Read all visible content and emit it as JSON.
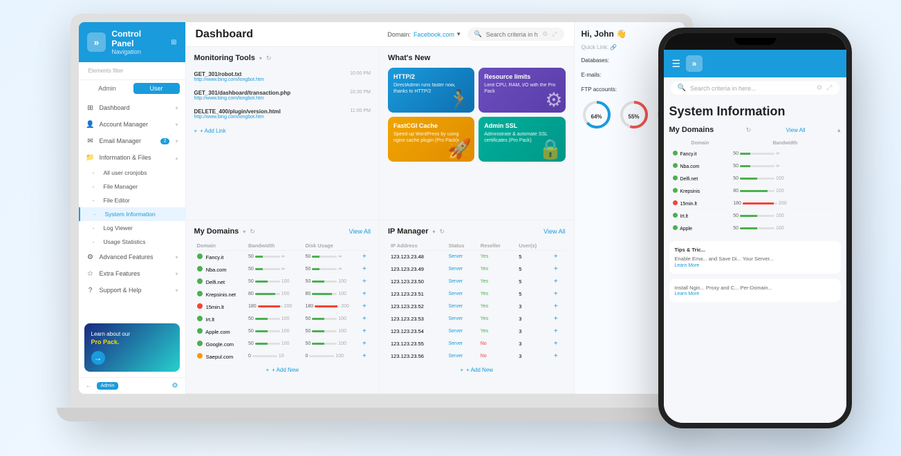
{
  "sidebar": {
    "logo": "»",
    "title": "Control Panel",
    "subtitle": "Navigation",
    "filter_label": "Elements filter",
    "tab_admin": "Admin",
    "tab_user": "User",
    "nav_items": [
      {
        "id": "dashboard",
        "label": "Dashboard",
        "icon": "⊞"
      },
      {
        "id": "account-manager",
        "label": "Account Manager",
        "icon": "👤"
      },
      {
        "id": "email-manager",
        "label": "Email Manager",
        "icon": "✉",
        "badge": "2"
      },
      {
        "id": "information-files",
        "label": "Information & Files",
        "icon": "📁",
        "expanded": true
      },
      {
        "id": "all-user-cronjobs",
        "label": "All user cronjobs",
        "icon": "",
        "sub": true
      },
      {
        "id": "file-manager",
        "label": "File Manager",
        "icon": "",
        "sub": true
      },
      {
        "id": "file-editor",
        "label": "File Editor",
        "icon": "",
        "sub": true
      },
      {
        "id": "system-information",
        "label": "System Information",
        "icon": "",
        "sub": true,
        "active": true
      },
      {
        "id": "log-viewer",
        "label": "Log Viewer",
        "icon": "",
        "sub": true
      },
      {
        "id": "usage-statistics",
        "label": "Usage Statistics",
        "icon": "",
        "sub": true
      },
      {
        "id": "advanced-features",
        "label": "Advanced Features",
        "icon": "⚙"
      },
      {
        "id": "extra-features",
        "label": "Extra Features",
        "icon": "★"
      },
      {
        "id": "support-help",
        "label": "Support & Help",
        "icon": "?"
      }
    ],
    "promo": {
      "text": "Learn about our",
      "highlight": "Pro Pack.",
      "button_label": "→"
    },
    "admin_label": "Admin"
  },
  "header": {
    "title": "Dashboard",
    "domain_label": "Domain:",
    "domain_value": "Facebook.com",
    "search_placeholder": "Search criteria in here..."
  },
  "monitoring_tools": {
    "title": "Monitoring Tools",
    "items": [
      {
        "method": "GET_301/robot.txt",
        "url": "http://www.bing.com/longbot.htm",
        "time": "10:00 PM"
      },
      {
        "method": "GET_301/dashboard/transaction.php",
        "url": "http://www.bing.com/longbot.htm",
        "time": "10:30 PM"
      },
      {
        "method": "DELETE_400/plugin/version.html",
        "url": "http://www.bing.com/longbot.htm",
        "time": "11:00 PM"
      }
    ],
    "add_link_label": "+ Add Link"
  },
  "whats_new": {
    "title": "What's New",
    "cards": [
      {
        "id": "http2",
        "title": "HTTP/2",
        "desc": "DirectAdmin runs faster now, thanks to HTTP/2",
        "color": "blue",
        "figure": "🏃"
      },
      {
        "id": "resource-limits",
        "title": "Resource limits",
        "desc": "Limit CPU, RAM, I/O with the Pro Pack",
        "color": "purple",
        "figure": "⚙"
      },
      {
        "id": "fastcgi-cache",
        "title": "FastCGI Cache",
        "desc": "Speed up WordPress by using nginx cache plugin (Pro Pack)",
        "color": "orange",
        "figure": "🚀"
      },
      {
        "id": "admin-ssl",
        "title": "Admin SSL",
        "desc": "Administrate & automate SSL certificates (Pro Pack)",
        "color": "teal",
        "figure": "🔒"
      }
    ]
  },
  "my_domains": {
    "title": "My Domains",
    "view_all": "View All",
    "columns": [
      "Domain",
      "Bandwidth",
      "Disk Usage",
      ""
    ],
    "rows": [
      {
        "name": "Fancy.it",
        "status": "green",
        "bw_used": 50,
        "bw_max": "∞",
        "disk_used": 50,
        "disk_max": "∞",
        "bw_pct": 30,
        "disk_pct": 30
      },
      {
        "name": "Nba.com",
        "status": "green",
        "bw_used": 50,
        "bw_max": "∞",
        "disk_used": 50,
        "disk_max": "∞",
        "bw_pct": 30,
        "disk_pct": 30
      },
      {
        "name": "Delfi.net",
        "status": "green",
        "bw_used": 50,
        "bw_max": 100,
        "disk_used": 50,
        "disk_max": 100,
        "bw_pct": 50,
        "disk_pct": 50
      },
      {
        "name": "Krepsinis.net",
        "status": "green",
        "bw_used": 80,
        "bw_max": 100,
        "disk_used": 80,
        "disk_max": 100,
        "bw_pct": 80,
        "disk_pct": 80
      },
      {
        "name": "15min.lt",
        "status": "red",
        "bw_used": 180,
        "bw_max": 200,
        "disk_used": 180,
        "disk_max": 200,
        "bw_pct": 90,
        "disk_pct": 90
      },
      {
        "name": "Irt.lt",
        "status": "green",
        "bw_used": 50,
        "bw_max": 100,
        "disk_used": 50,
        "disk_max": 100,
        "bw_pct": 50,
        "disk_pct": 50
      },
      {
        "name": "Apple.com",
        "status": "green",
        "bw_used": 50,
        "bw_max": 100,
        "disk_used": 50,
        "disk_max": 100,
        "bw_pct": 50,
        "disk_pct": 50
      },
      {
        "name": "Google.com",
        "status": "green",
        "bw_used": 50,
        "bw_max": 100,
        "disk_used": 50,
        "disk_max": 100,
        "bw_pct": 50,
        "disk_pct": 50
      },
      {
        "name": "Saepul.com",
        "status": "orange",
        "bw_used": 0,
        "bw_max": 10,
        "disk_used": 0,
        "disk_max": 100,
        "bw_pct": 0,
        "disk_pct": 0
      }
    ],
    "add_new_label": "+ Add New"
  },
  "ip_manager": {
    "title": "IP Manager",
    "view_all": "View All",
    "columns": [
      "IP Address",
      "Status",
      "Reseller",
      "User(s)",
      ""
    ],
    "rows": [
      {
        "ip": "123.123.23.48",
        "status": "Server",
        "reseller": "Yes",
        "users": 5
      },
      {
        "ip": "123.123.23.49",
        "status": "Server",
        "reseller": "Yes",
        "users": 5
      },
      {
        "ip": "123.123.23.50",
        "status": "Server",
        "reseller": "Yes",
        "users": 5
      },
      {
        "ip": "123.123.23.51",
        "status": "Server",
        "reseller": "Yes",
        "users": 5
      },
      {
        "ip": "123.123.23.52",
        "status": "Server",
        "reseller": "Yes",
        "users": 3
      },
      {
        "ip": "123.123.23.53",
        "status": "Server",
        "reseller": "Yes",
        "users": 3
      },
      {
        "ip": "123.123.23.54",
        "status": "Server",
        "reseller": "Yes",
        "users": 3
      },
      {
        "ip": "123.123.23.55",
        "status": "Server",
        "reseller": "No",
        "users": 3
      },
      {
        "ip": "123.123.23.56",
        "status": "Server",
        "reseller": "No",
        "users": 3
      }
    ],
    "add_new_label": "+ Add New"
  },
  "right_panel": {
    "greeting": "Hi, John 👋",
    "quick_link_label": "Quick Link: 🔗",
    "links": [
      "Databases:",
      "E-mails:",
      "FTP accounts:"
    ],
    "ring1_pct": 64,
    "ring2_pct": 55
  },
  "phone": {
    "logo": "»",
    "search_placeholder": "Search criteria in here...",
    "sys_info_title": "System Information",
    "my_domains_title": "My Domains",
    "view_all": "View All",
    "domain_col": "Domain",
    "bandwidth_col": "Bandwidth",
    "domains": [
      {
        "name": "Fancy.it",
        "status": "green",
        "bw_used": 50,
        "bw_max": "∞",
        "bw_pct": 30
      },
      {
        "name": "Nba.com",
        "status": "green",
        "bw_used": 50,
        "bw_max": "∞",
        "bw_pct": 30
      },
      {
        "name": "Delfi.net",
        "status": "green",
        "bw_used": 50,
        "bw_max": 100,
        "bw_pct": 50
      },
      {
        "name": "Krepsinis",
        "status": "green",
        "bw_used": 80,
        "bw_max": 100,
        "bw_pct": 80
      },
      {
        "name": "15min.lt",
        "status": "red",
        "bw_used": 180,
        "bw_max": 200,
        "bw_pct": 90
      },
      {
        "name": "Irt.lt",
        "status": "green",
        "bw_used": 50,
        "bw_max": 100,
        "bw_pct": 50
      },
      {
        "name": "Apple",
        "status": "green",
        "bw_used": 50,
        "bw_max": 100,
        "bw_pct": 50
      }
    ],
    "tips_title": "Tips & Tric...",
    "tips1": "Enable Ema... and Save Di... Your Server...",
    "tips1_link": "Learn More",
    "tips2": "Install Ngin... Proxy and C... Per-Domain...",
    "tips2_link": "Learn More"
  }
}
